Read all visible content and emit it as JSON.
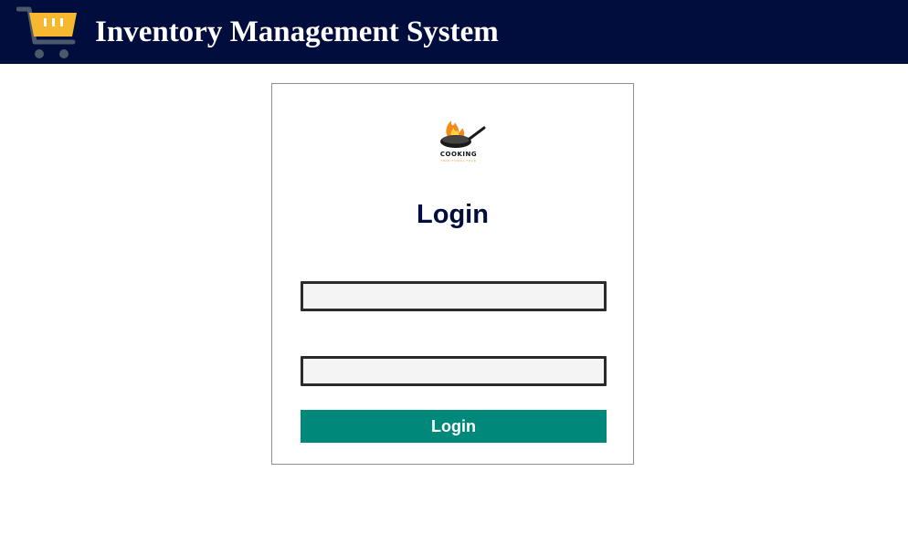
{
  "header": {
    "title": "Inventory Management System",
    "icon": "shopping-cart-icon",
    "background": "#000d3d",
    "icon_color": "#f5b82e",
    "wheel_color": "#4a5a6a"
  },
  "login": {
    "logo": {
      "icon": "cooking-pan-flame-logo",
      "text": "COOKING",
      "subtext": "TRADITIONAL FOOD"
    },
    "heading": "Login",
    "username": {
      "value": "",
      "placeholder": ""
    },
    "password": {
      "value": "",
      "placeholder": ""
    },
    "button_label": "Login",
    "button_color": "#00897b"
  }
}
